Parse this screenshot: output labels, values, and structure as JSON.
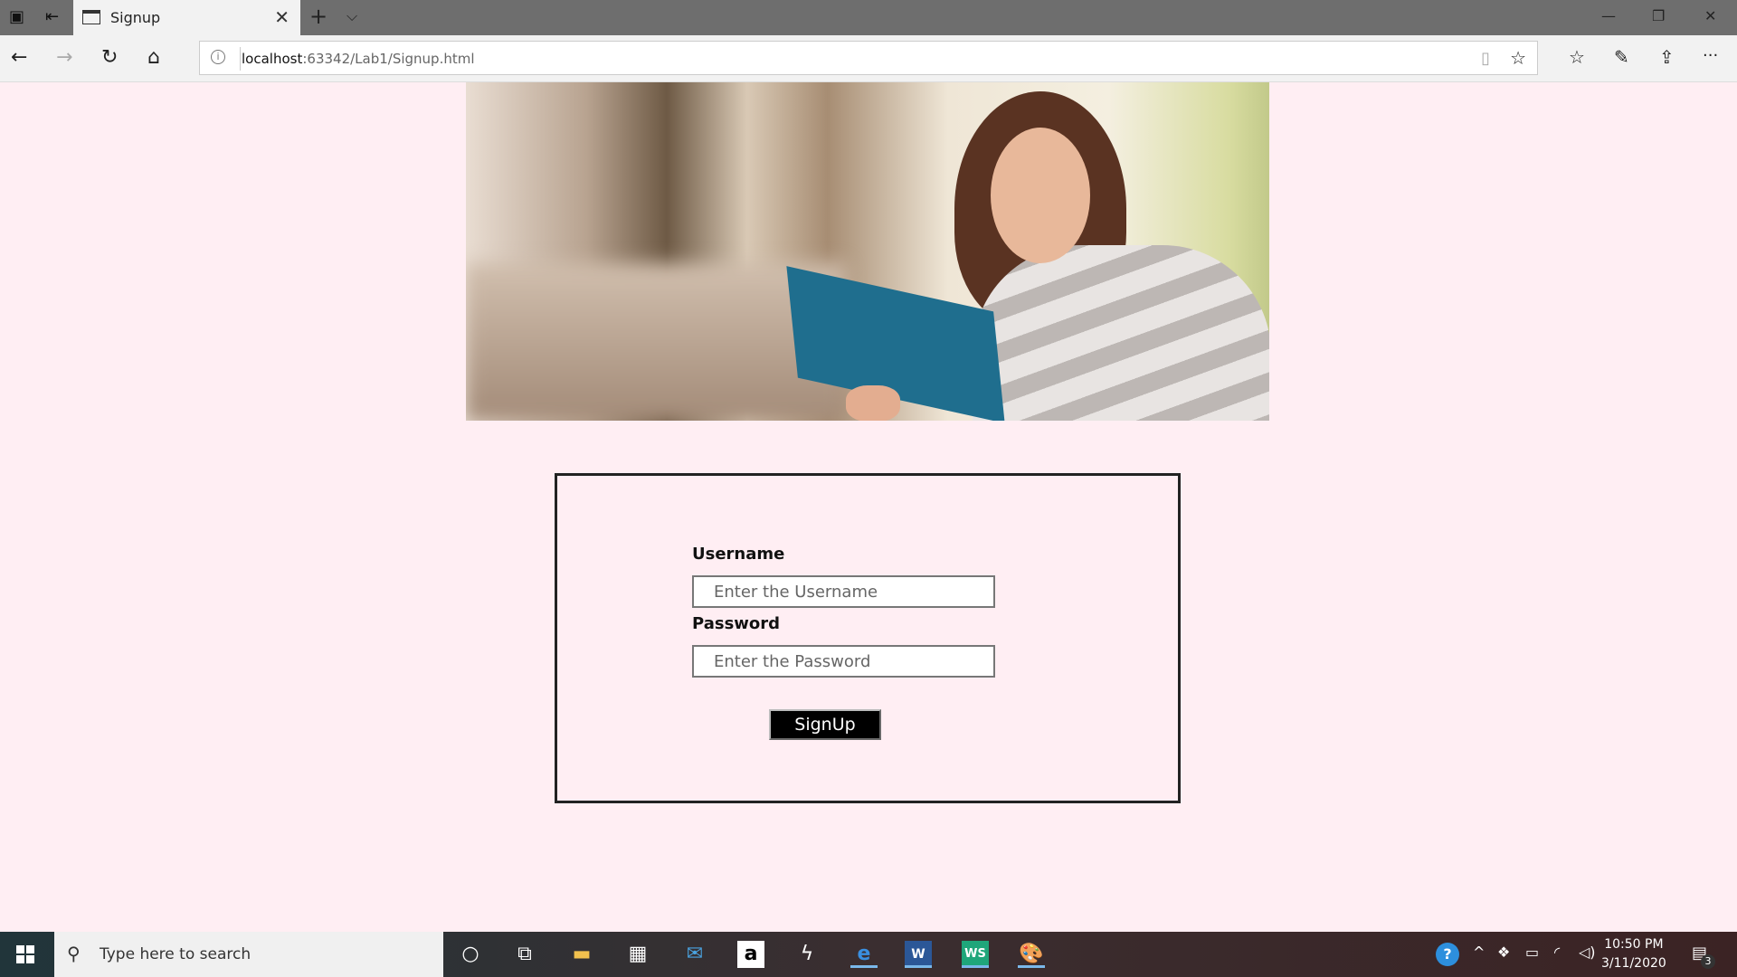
{
  "browser": {
    "tab_title": "Signup",
    "url_host": "localhost",
    "url_path": ":63342/Lab1/Signup.html",
    "icons": [
      "tab-set-aside-icon",
      "tab-preview-icon",
      "back-icon",
      "forward-icon",
      "refresh-icon",
      "home-icon",
      "info-icon",
      "reading-view-icon",
      "favorite-star-icon",
      "favorites-icon",
      "pen-icon",
      "share-icon",
      "more-icon"
    ]
  },
  "form": {
    "username_label": "Username",
    "username_placeholder": "Enter the Username",
    "password_label": "Password",
    "password_placeholder": "Enter the Password",
    "submit_label": "SignUp"
  },
  "taskbar": {
    "search_placeholder": "Type here to search",
    "time": "10:50 PM",
    "date": "3/11/2020",
    "notification_count": "3"
  }
}
